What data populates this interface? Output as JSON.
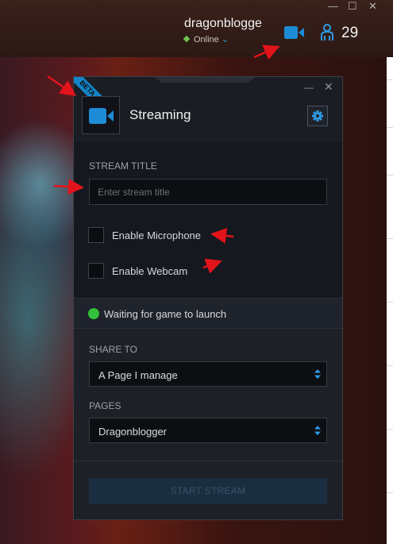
{
  "window": {
    "min_glyph": "—",
    "max_glyph": "☐",
    "close_glyph": "✕"
  },
  "user": {
    "name": "dragonblogge",
    "status": "Online",
    "friends_count": "29"
  },
  "panel": {
    "badge": "BETA",
    "title": "Streaming",
    "min_glyph": "—",
    "close_glyph": "✕",
    "stream_title_label": "STREAM TITLE",
    "stream_title_placeholder": "Enter stream title",
    "stream_title_value": "",
    "mic_label": "Enable Microphone",
    "mic_checked": false,
    "webcam_label": "Enable Webcam",
    "webcam_checked": false,
    "status_text": "Waiting for game to launch",
    "share_to_label": "SHARE TO",
    "share_to_value": "A Page I manage",
    "pages_label": "PAGES",
    "pages_value": "Dragonblogger",
    "start_button": "START STREAM"
  },
  "icons": [
    "video-camera-icon",
    "friends-icon",
    "gear-icon",
    "status-dot-icon",
    "select-arrows-icon"
  ],
  "colors": {
    "accent": "#1e8bd6",
    "online": "#6cc84a",
    "waiting": "#33c03a",
    "panel_bg": "#1d2027",
    "annotation": "#e3131b"
  }
}
